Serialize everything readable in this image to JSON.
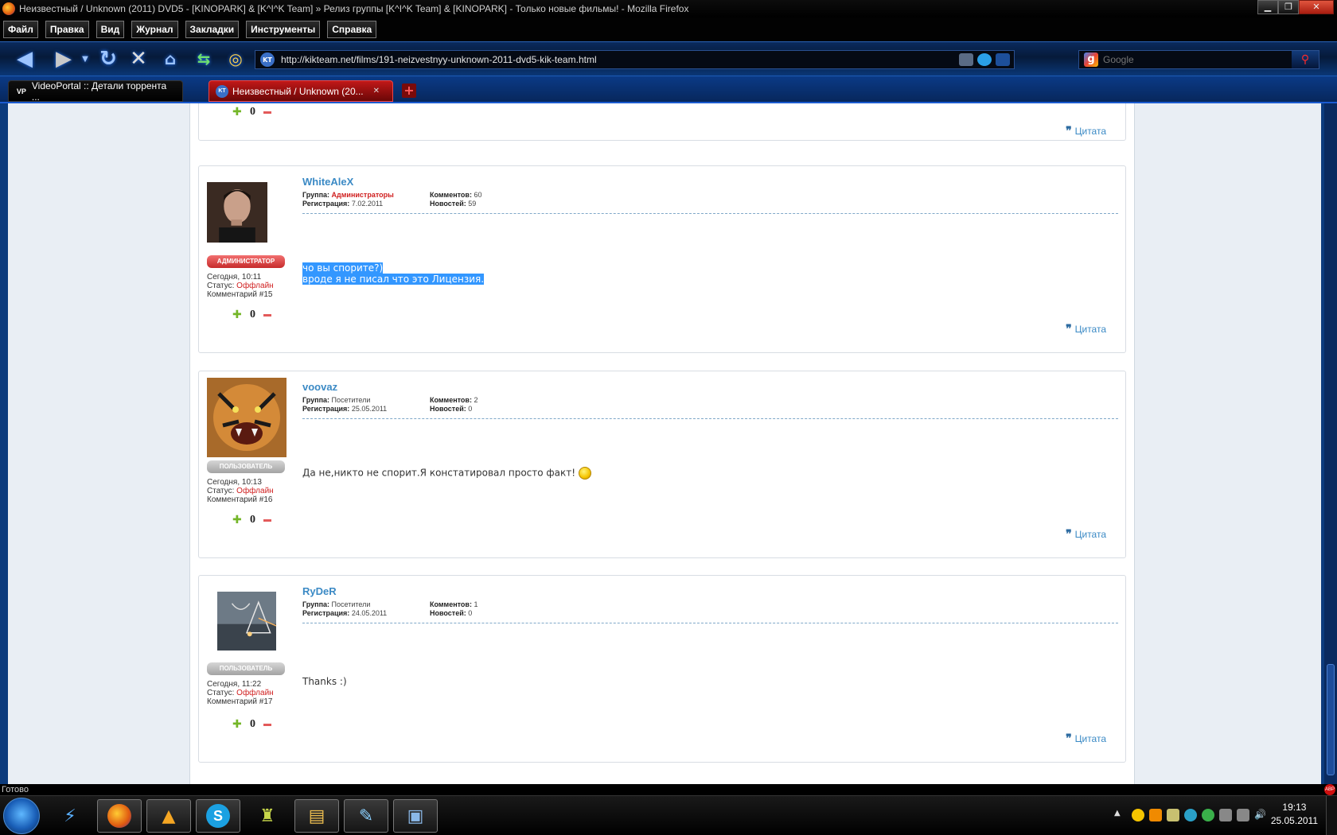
{
  "window": {
    "title": "Неизвестный / Unknown (2011) DVD5 - [KINOPARK] & [K^I^K Team] » Релиз группы [K^I^K Team] & [KINOPARK] - Только новые фильмы! - Mozilla Firefox"
  },
  "menu": [
    "Файл",
    "Правка",
    "Вид",
    "Журнал",
    "Закладки",
    "Инструменты",
    "Справка"
  ],
  "nav": {
    "site_icon": "KT",
    "url": "http://kikteam.net/films/191-neizvestnyy-unknown-2011-dvd5-kik-team.html",
    "search_engine": "g",
    "search_placeholder": "Google"
  },
  "tabs": [
    {
      "icon": "VP",
      "label": "VideoPortal :: Детали торрента ...",
      "active": false
    },
    {
      "icon": "KT",
      "label": "Неизвестный / Unknown (20...",
      "active": true
    }
  ],
  "comments": [
    {
      "partial": true,
      "rating": "0",
      "quote_label": "Цитата"
    },
    {
      "author": "WhiteAleX",
      "badge": "АДМИНИСТРАТОР",
      "badge_type": "admin",
      "group_label": "Группа:",
      "group": "Администраторы",
      "reg_label": "Регистрация:",
      "reg": "7.02.2011",
      "comments_label": "Комментов:",
      "comments_count": "60",
      "news_label": "Новостей:",
      "news_count": "59",
      "time": "Сегодня, 10:11",
      "status_label": "Статус:",
      "status": "Оффлайн",
      "comment_no": "Комментарий #15",
      "lines": [
        "чо вы спорите?)",
        "вроде я не писал что это Лицензия."
      ],
      "rating": "0",
      "quote_label": "Цитата"
    },
    {
      "author": "voovaz",
      "badge": "ПОЛЬЗОВАТЕЛЬ",
      "badge_type": "user",
      "group_label": "Группа:",
      "group": "Посетители",
      "reg_label": "Регистрация:",
      "reg": "25.05.2011",
      "comments_label": "Комментов:",
      "comments_count": "2",
      "news_label": "Новостей:",
      "news_count": "0",
      "time": "Сегодня, 10:13",
      "status_label": "Статус:",
      "status": "Оффлайн",
      "comment_no": "Комментарий #16",
      "lines": [
        "Да не,никто не спорит.Я констатировал просто факт!"
      ],
      "rating": "0",
      "quote_label": "Цитата"
    },
    {
      "author": "RyDeR",
      "badge": "ПОЛЬЗОВАТЕЛЬ",
      "badge_type": "user",
      "group_label": "Группа:",
      "group": "Посетители",
      "reg_label": "Регистрация:",
      "reg": "24.05.2011",
      "comments_label": "Комментов:",
      "comments_count": "1",
      "news_label": "Новостей:",
      "news_count": "0",
      "time": "Сегодня, 11:22",
      "status_label": "Статус:",
      "status": "Оффлайн",
      "comment_no": "Комментарий #17",
      "lines": [
        "Thanks :)"
      ],
      "rating": "0",
      "quote_label": "Цитата"
    }
  ],
  "statusbar": {
    "text": "Готово",
    "abp": "ABP"
  },
  "taskbar": {
    "time": "19:13",
    "date": "25.05.2011",
    "apps": [
      "windows-start",
      "bolt-app",
      "firefox",
      "aimp",
      "skype",
      "game-app",
      "explorer",
      "paint",
      "image-viewer"
    ]
  },
  "colors": {
    "link": "#3b8ac5",
    "offline": "#d02020",
    "selection": "#3397ff",
    "tab_active": "#c01818",
    "page_bg": "#0c3b7d"
  }
}
